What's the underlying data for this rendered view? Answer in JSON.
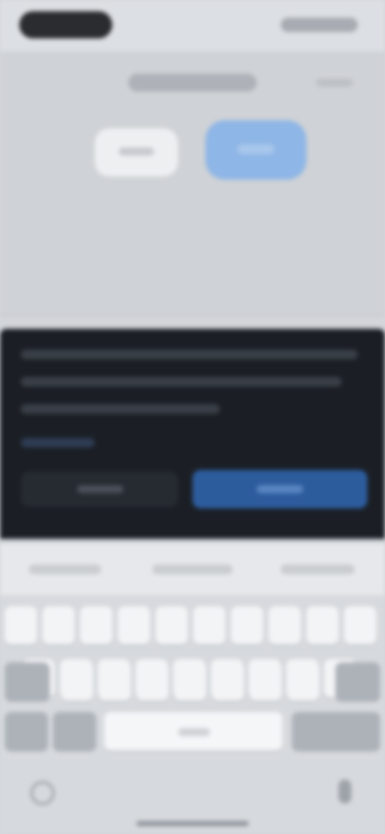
{
  "status_bar": {
    "time": ""
  },
  "header": {
    "title": ""
  },
  "colors": {
    "accent": "#8eb6e6",
    "sheet_background": "#1b1f25",
    "primary_button": "#2d5c9d",
    "keyboard_background": "#d6d9dd"
  },
  "icons": {
    "globe": "globe-icon",
    "microphone": "mic-icon",
    "signal": "signal-icon",
    "battery": "battery-icon"
  }
}
